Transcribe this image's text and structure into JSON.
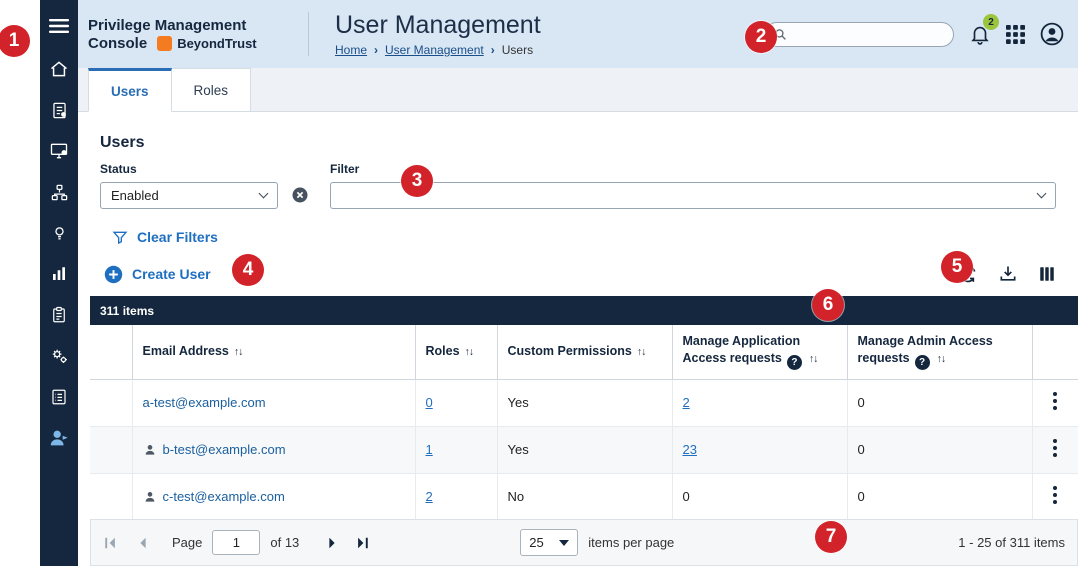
{
  "colors": {
    "annotation_red": "#d2232a",
    "navy": "#15273e",
    "link_blue": "#1f6fc0",
    "header_bg": "#d9e6f3",
    "brand_orange": "#f47b20",
    "badge_green": "#9bc53d",
    "active_tab_blue": "#2a6db4"
  },
  "annotations": {
    "numbers": [
      "1",
      "2",
      "3",
      "4",
      "5",
      "6",
      "7"
    ]
  },
  "sidebar": {
    "icons": [
      "hamburger-menu",
      "home",
      "events",
      "computers",
      "computer-groups",
      "policies",
      "analytics",
      "reports",
      "configuration",
      "auditing",
      "user-management"
    ],
    "active_item": "user-management"
  },
  "header": {
    "app_title_line1": "Privilege Management",
    "app_title_line2": "Console",
    "brand_name": "BeyondTrust",
    "page_title": "User Management",
    "breadcrumb": {
      "home": "Home",
      "separator": "›",
      "section": "User Management",
      "current": "Users"
    },
    "notification_badge": "2"
  },
  "tabs": {
    "users": "Users",
    "roles": "Roles"
  },
  "filters": {
    "section_title": "Users",
    "status_label": "Status",
    "status_value": "Enabled",
    "filter_label": "Filter",
    "filter_value": "",
    "clear_filters_label": "Clear Filters",
    "create_user_label": "Create User"
  },
  "table": {
    "summary": "311 items",
    "sort_glyph": "↑↓",
    "help_glyph": "?",
    "headers": {
      "email": "Email Address",
      "roles": "Roles",
      "custom_permissions": "Custom Permissions",
      "app_requests": "Manage Application Access requests",
      "admin_requests": "Manage Admin Access requests"
    },
    "rows": [
      {
        "email": "a-test@example.com",
        "roles": "0",
        "custom_permissions": "Yes",
        "app_requests": "2",
        "admin_requests": "0"
      },
      {
        "email": "b-test@example.com",
        "roles": "1",
        "custom_permissions": "Yes",
        "app_requests": "23",
        "admin_requests": "0"
      },
      {
        "email": "c-test@example.com",
        "roles": "2",
        "custom_permissions": "No",
        "app_requests": "0",
        "admin_requests": "0"
      }
    ]
  },
  "pagination": {
    "page_label": "Page",
    "current_page": "1",
    "total_pages": "of 13",
    "per_page": "25",
    "per_page_label": "items per page",
    "range": "1 - 25 of 311 items"
  }
}
